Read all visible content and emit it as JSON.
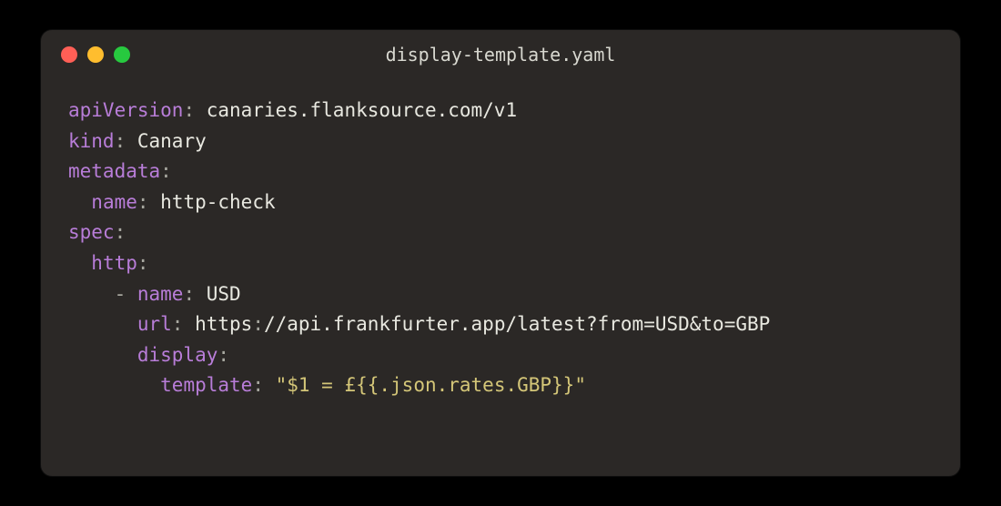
{
  "window": {
    "title": "display-template.yaml"
  },
  "code": {
    "line1_key": "apiVersion",
    "line1_val": "canaries.flanksource.com/v1",
    "line2_key": "kind",
    "line2_val": "Canary",
    "line3_key": "metadata",
    "line4_key": "name",
    "line4_val": "http-check",
    "line5_key": "spec",
    "line6_key": "http",
    "line7_key": "name",
    "line7_val": "USD",
    "line8_key": "url",
    "line8_prefix": "https",
    "line8_rest": "//api.frankfurter.app/latest?from=USD&to=GBP",
    "line9_key": "display",
    "line10_key": "template",
    "line10_val": "\"$1 = £{{.json.rates.GBP}}\""
  }
}
